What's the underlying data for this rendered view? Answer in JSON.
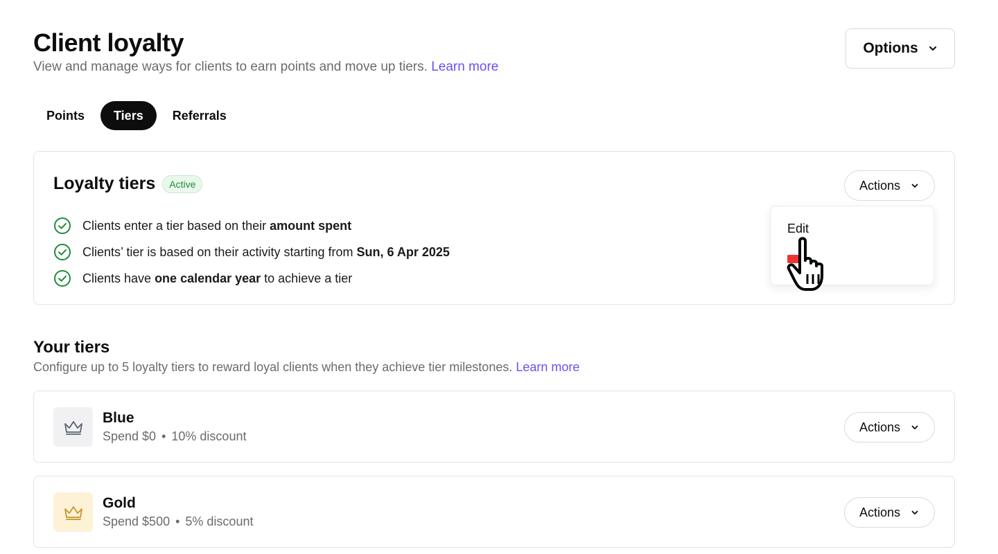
{
  "header": {
    "title": "Client loyalty",
    "subtitle": "View and manage ways for clients to earn points and move up tiers.",
    "learn_more": "Learn more",
    "options_label": "Options"
  },
  "tabs": [
    {
      "label": "Points",
      "active": false
    },
    {
      "label": "Tiers",
      "active": true
    },
    {
      "label": "Referrals",
      "active": false
    }
  ],
  "loyalty_card": {
    "title": "Loyalty tiers",
    "status_badge": "Active",
    "actions_label": "Actions",
    "rules": [
      {
        "pre": "Clients enter a tier based on their ",
        "bold": "amount spent",
        "post": ""
      },
      {
        "pre": "Clients’ tier is based on their activity starting from ",
        "bold": "Sun, 6 Apr 2025",
        "post": ""
      },
      {
        "pre": "Clients have ",
        "bold": "one calendar year",
        "post": " to achieve a tier"
      }
    ],
    "dropdown": {
      "items": [
        "Edit"
      ]
    }
  },
  "your_tiers": {
    "title": "Your tiers",
    "subtitle": "Configure up to 5 loyalty tiers to reward loyal clients when they achieve tier milestones.",
    "learn_more": "Learn more",
    "tiers": [
      {
        "name": "Blue",
        "spend": "Spend $0",
        "discount": "10% discount",
        "actions_label": "Actions",
        "icon_bg": "#f1f1f3",
        "icon_color": "#5a6270"
      },
      {
        "name": "Gold",
        "spend": "Spend $500",
        "discount": "5% discount",
        "actions_label": "Actions",
        "icon_bg": "#fdf2d6",
        "icon_color": "#c7932a"
      }
    ]
  },
  "colors": {
    "accent": "#6950f3",
    "success": "#1e8a3a",
    "text": "#0d0d0d",
    "muted": "#6b6b6b"
  }
}
